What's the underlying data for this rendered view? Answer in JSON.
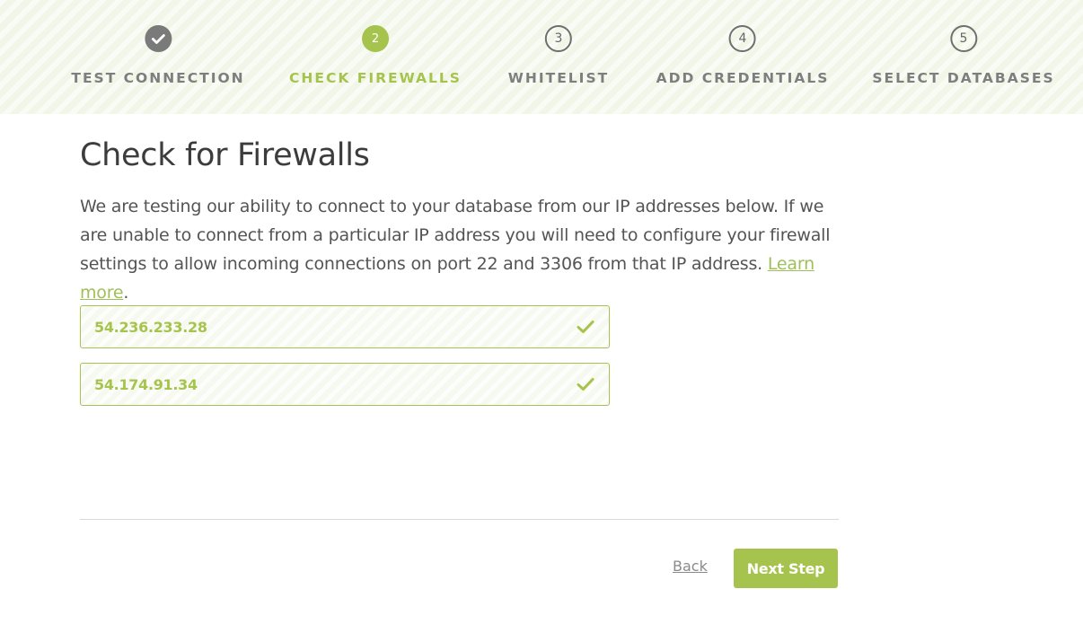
{
  "steps": [
    {
      "label": "TEST CONNECTION",
      "status": "done",
      "icon": "check-icon"
    },
    {
      "label": "CHECK FIREWALLS",
      "status": "active",
      "number": "2"
    },
    {
      "label": "WHITELIST",
      "status": "todo",
      "number": "3"
    },
    {
      "label": "ADD CREDENTIALS",
      "status": "todo",
      "number": "4"
    },
    {
      "label": "SELECT DATABASES",
      "status": "todo",
      "number": "5"
    }
  ],
  "main": {
    "title": "Check for Firewalls",
    "description": "We are testing our ability to connect to your database from our IP addresses below. If we are unable to connect from a particular IP address you will need to configure your firewall settings to allow incoming connections on port 22 and 3306 from that IP address.",
    "learn_more": "Learn more",
    "period": "."
  },
  "ips": [
    {
      "address": "54.236.233.28",
      "status": "success",
      "icon": "check-icon"
    },
    {
      "address": "54.174.91.34",
      "status": "success",
      "icon": "check-icon"
    }
  ],
  "footer": {
    "back_label": "Back",
    "next_label": "Next Step"
  },
  "colors": {
    "accent": "#a6c44d",
    "stepper_bg": "#f1f6e8",
    "muted": "#7e7e7e"
  }
}
